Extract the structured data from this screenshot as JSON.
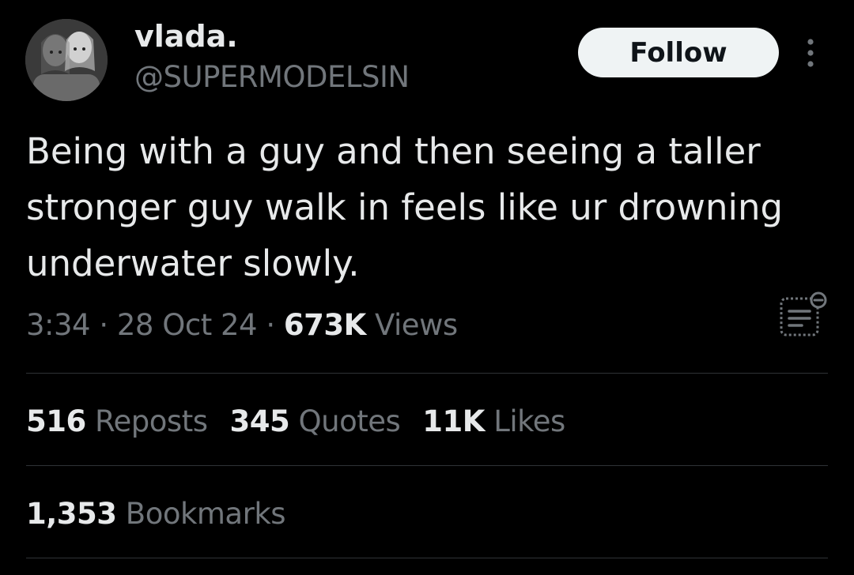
{
  "author": {
    "display_name": "vlada.",
    "handle": "@SUPERMODELSIN"
  },
  "header": {
    "follow_label": "Follow",
    "more_icon": "more-vertical-icon"
  },
  "tweet": {
    "text": "Being with a guy and then seeing a taller stronger guy walk in feels like ur drowning underwater slowly."
  },
  "meta": {
    "time": "3:34",
    "separator": " · ",
    "date": "28 Oct 24",
    "views_count": "673K",
    "views_label": " Views",
    "analytics_icon": "post-analytics-icon"
  },
  "stats": {
    "reposts_count": "516",
    "reposts_label": " Reposts",
    "quotes_count": "345",
    "quotes_label": " Quotes",
    "likes_count": "11K",
    "likes_label": " Likes",
    "bookmarks_count": "1,353",
    "bookmarks_label": " Bookmarks"
  },
  "colors": {
    "background": "#000000",
    "primary_text": "#e7e9ea",
    "secondary_text": "#71767b",
    "divider": "#2f3336",
    "button_bg": "#eff3f4",
    "button_text": "#0f1419"
  }
}
